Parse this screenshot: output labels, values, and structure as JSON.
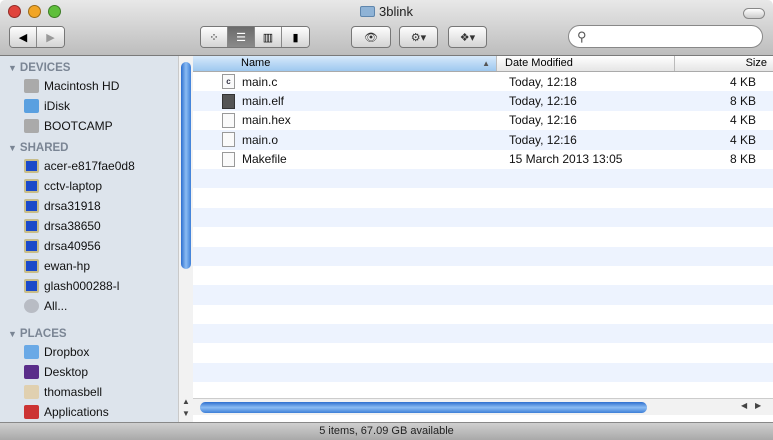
{
  "window": {
    "title": "3blink"
  },
  "toolbar": {
    "back": "◀",
    "forward": "▶",
    "views": [
      "⁘",
      "☰",
      "▥",
      "▮"
    ],
    "quicklook": "👁",
    "action": "⚙▾",
    "dropbox": "❖▾",
    "search_placeholder": ""
  },
  "sidebar": {
    "devices": {
      "label": "DEVICES",
      "items": [
        "Macintosh HD",
        "iDisk",
        "BOOTCAMP"
      ]
    },
    "shared": {
      "label": "SHARED",
      "items": [
        "acer-e817fae0d8",
        "cctv-laptop",
        "drsa31918",
        "drsa38650",
        "drsa40956",
        "ewan-hp",
        "glash000288-l",
        "All..."
      ]
    },
    "places": {
      "label": "PLACES",
      "items": [
        "Dropbox",
        "Desktop",
        "thomasbell",
        "Applications"
      ]
    }
  },
  "columns": {
    "name": "Name",
    "date": "Date Modified",
    "size": "Size"
  },
  "files": [
    {
      "name": "main.c",
      "date": "Today, 12:18",
      "size": "4 KB",
      "icon": "c-source"
    },
    {
      "name": "main.elf",
      "date": "Today, 12:16",
      "size": "8 KB",
      "icon": "executable"
    },
    {
      "name": "main.hex",
      "date": "Today, 12:16",
      "size": "4 KB",
      "icon": "document"
    },
    {
      "name": "main.o",
      "date": "Today, 12:16",
      "size": "4 KB",
      "icon": "document"
    },
    {
      "name": "Makefile",
      "date": "15 March 2013 13:05",
      "size": "8 KB",
      "icon": "document"
    }
  ],
  "status": "5 items, 67.09 GB available"
}
